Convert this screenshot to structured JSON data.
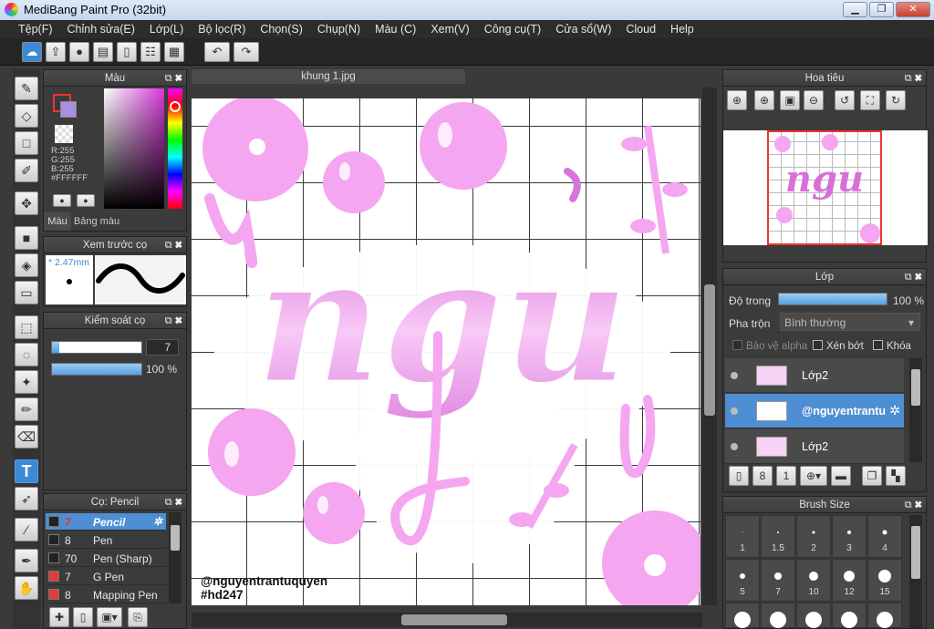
{
  "app": {
    "title": "MediBang Paint Pro (32bit)"
  },
  "menu": [
    "Tệp(F)",
    "Chỉnh sửa(E)",
    "Lớp(L)",
    "Bộ lọc(R)",
    "Chọn(S)",
    "Chụp(N)",
    "Màu (C)",
    "Xem(V)",
    "Công cụ(T)",
    "Cửa sổ(W)",
    "Cloud",
    "Help"
  ],
  "color_panel": {
    "title": "Màu",
    "r": "R:255",
    "g": "G:255",
    "b": "B:255",
    "hex": "#FFFFFF",
    "tab_color": "Màu",
    "tab_palette": "Bảng màu",
    "primary_color": "#ffffff",
    "secondary_color": "#a98fe0"
  },
  "preview_panel": {
    "title": "Xem trước cọ",
    "size": "* 2.47mm"
  },
  "control_panel": {
    "title": "Kiểm soát cọ",
    "size_value": "7",
    "opacity_value": "100 %",
    "opacity": 1.0,
    "size_fill": 0.08
  },
  "brush_panel": {
    "title": "Cọ: Pencil",
    "brushes": [
      {
        "size": "7",
        "name": "Pencil",
        "color": "#222222"
      },
      {
        "size": "8",
        "name": "Pen",
        "color": "#222222"
      },
      {
        "size": "70",
        "name": "Pen (Sharp)",
        "color": "#222222"
      },
      {
        "size": "7",
        "name": "G Pen",
        "color": "#e33b3b"
      },
      {
        "size": "8",
        "name": "Mapping Pen",
        "color": "#e33b3b"
      }
    ]
  },
  "document": {
    "tab": "khung 1.jpg",
    "lettering": "ngu",
    "credit_line1": "@nguyentrantuquyen",
    "credit_line2": "#hd247",
    "pink": "#f4a6f0",
    "pink_dark": "#d775da"
  },
  "navigator": {
    "title": "Hoa tiêu",
    "thumb_text": "ngu"
  },
  "layers_panel": {
    "title": "Lớp",
    "opacity_label": "Độ trong",
    "opacity_value": "100 %",
    "blend_label": "Pha trộn",
    "blend_value": "Bình thường",
    "protect_alpha": "Bảo vệ alpha",
    "clipping": "Xén bớt",
    "lock": "Khóa",
    "layers": [
      {
        "name": "Lớp2",
        "selected": false
      },
      {
        "name": "@nguyentrantu",
        "selected": true
      },
      {
        "name": "Lớp2",
        "selected": false
      }
    ]
  },
  "brush_size_panel": {
    "title": "Brush Size",
    "sizes": [
      "1",
      "1.5",
      "2",
      "3",
      "4",
      "5",
      "7",
      "10",
      "12",
      "15"
    ]
  }
}
